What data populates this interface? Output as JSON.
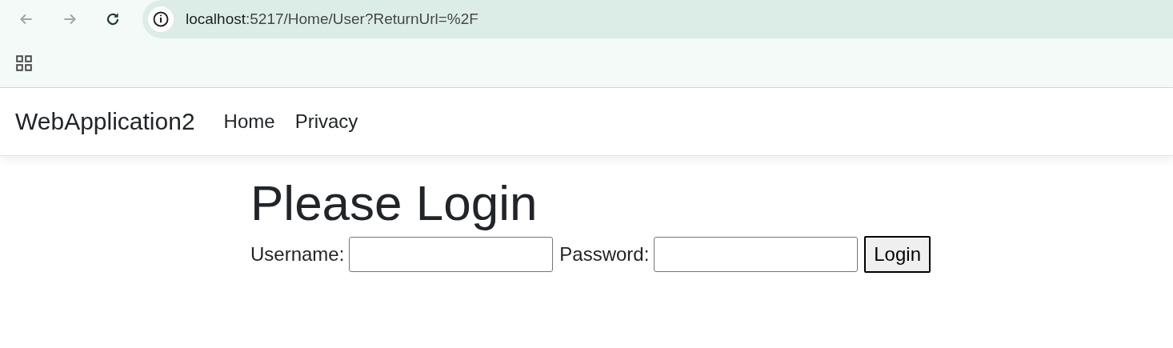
{
  "browser": {
    "back": {
      "disabled": true
    },
    "forward": {
      "disabled": true
    },
    "url": {
      "host": "localhost",
      "rest": ":5217/Home/User?ReturnUrl=%2F"
    }
  },
  "navbar": {
    "brand": "WebApplication2",
    "links": [
      "Home",
      "Privacy"
    ]
  },
  "heading": "Please Login",
  "form": {
    "username_label": "Username:",
    "password_label": "Password:",
    "button": "Login"
  }
}
